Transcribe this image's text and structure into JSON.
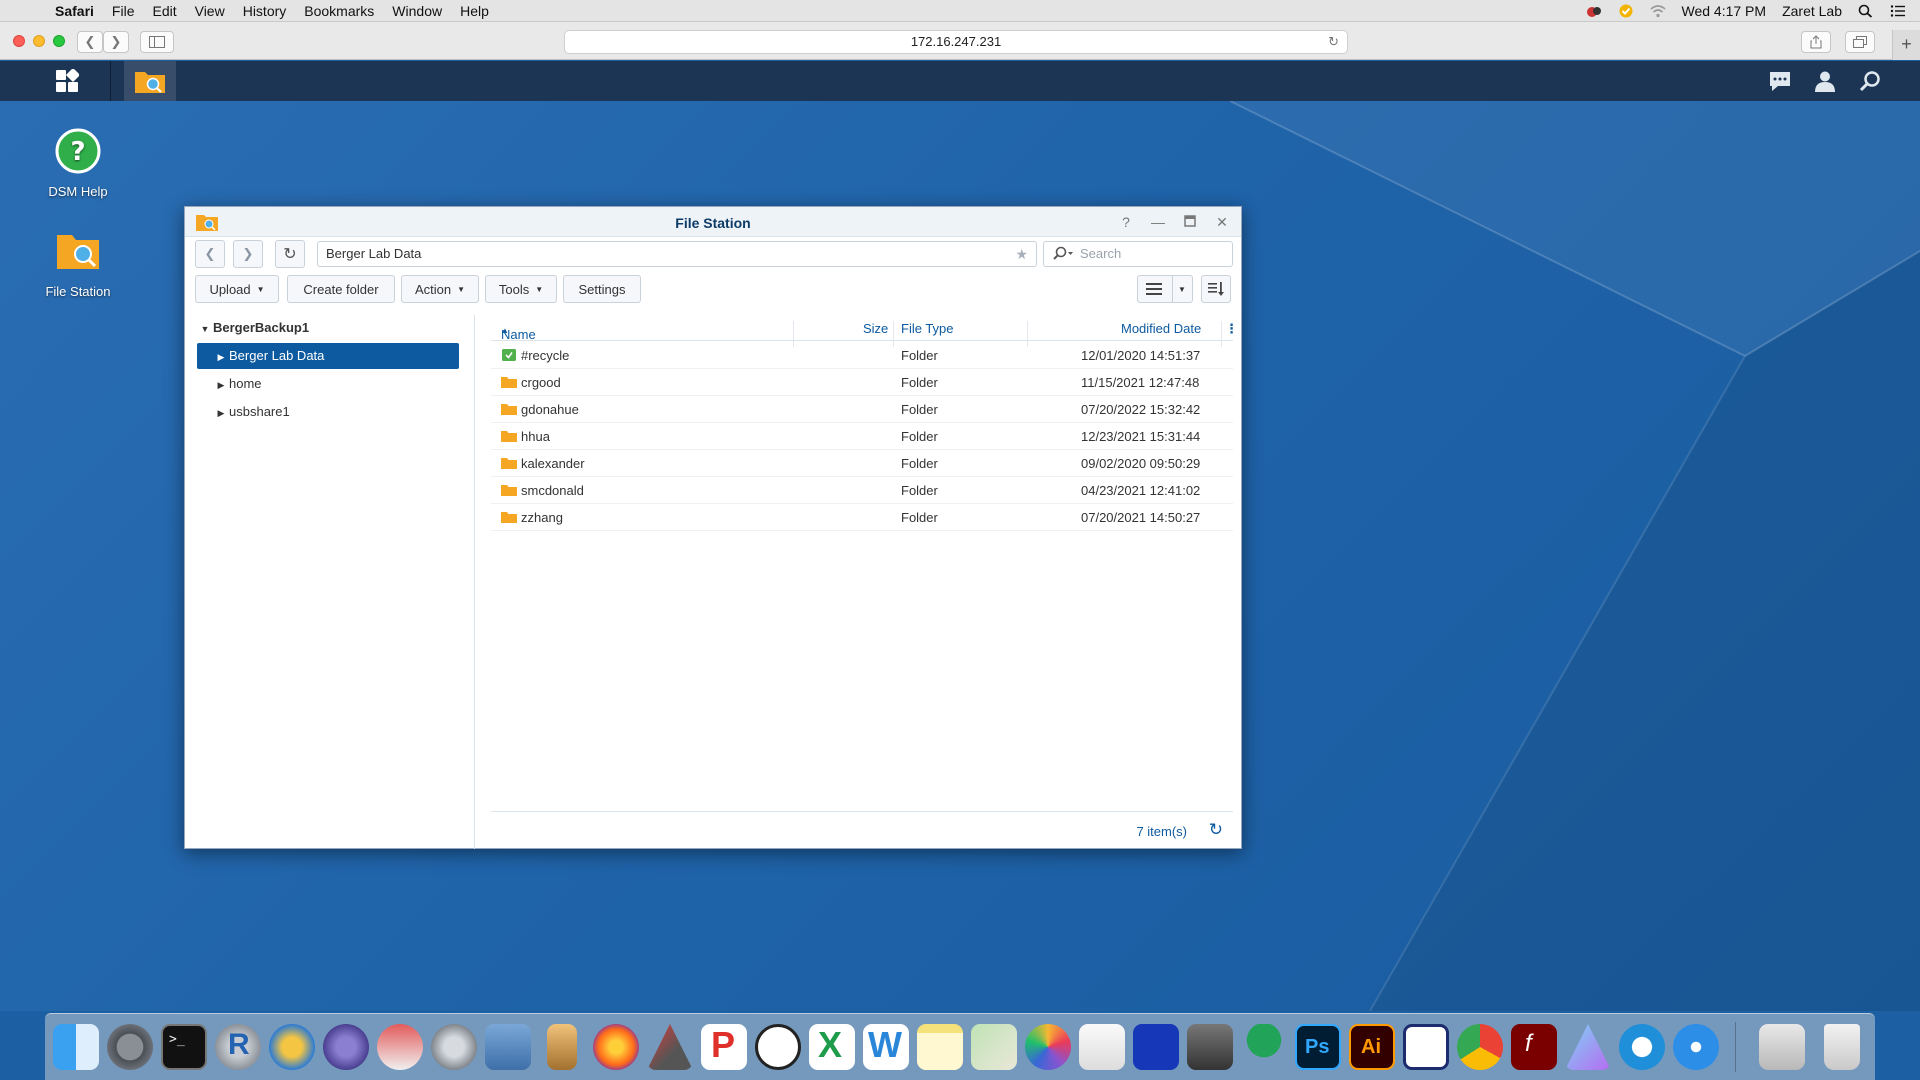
{
  "menubar": {
    "app": "Safari",
    "items": [
      "File",
      "Edit",
      "View",
      "History",
      "Bookmarks",
      "Window",
      "Help"
    ],
    "clock": "Wed 4:17 PM",
    "user": "Zaret Lab"
  },
  "browser": {
    "url": "172.16.247.231"
  },
  "desktop": {
    "icons": [
      {
        "label": "DSM Help"
      },
      {
        "label": "File Station"
      }
    ]
  },
  "window": {
    "title": "File Station",
    "path": "Berger Lab Data",
    "search_placeholder": "Search",
    "toolbar": {
      "upload": "Upload",
      "create_folder": "Create folder",
      "action": "Action",
      "tools": "Tools",
      "settings": "Settings"
    },
    "tree": {
      "root": "BergerBackup1",
      "items": [
        "Berger Lab Data",
        "home",
        "usbshare1"
      ]
    },
    "columns": {
      "name": "Name",
      "size": "Size",
      "type": "File Type",
      "modified": "Modified Date"
    },
    "rows": [
      {
        "name": "#recycle",
        "type": "Folder",
        "modified": "12/01/2020 14:51:37"
      },
      {
        "name": "crgood",
        "type": "Folder",
        "modified": "11/15/2021 12:47:48"
      },
      {
        "name": "gdonahue",
        "type": "Folder",
        "modified": "07/20/2022 15:32:42"
      },
      {
        "name": "hhua",
        "type": "Folder",
        "modified": "12/23/2021 15:31:44"
      },
      {
        "name": "kalexander",
        "type": "Folder",
        "modified": "09/02/2020 09:50:29"
      },
      {
        "name": "smcdonald",
        "type": "Folder",
        "modified": "04/23/2021 12:41:02"
      },
      {
        "name": "zzhang",
        "type": "Folder",
        "modified": "07/20/2021 14:50:27"
      }
    ],
    "item_count": "7 item(s)"
  },
  "colors": {
    "desktop": "#1f63a9",
    "selection": "#0d5aa0",
    "folder": "#f5a623",
    "title_text": "#0e3b66"
  }
}
